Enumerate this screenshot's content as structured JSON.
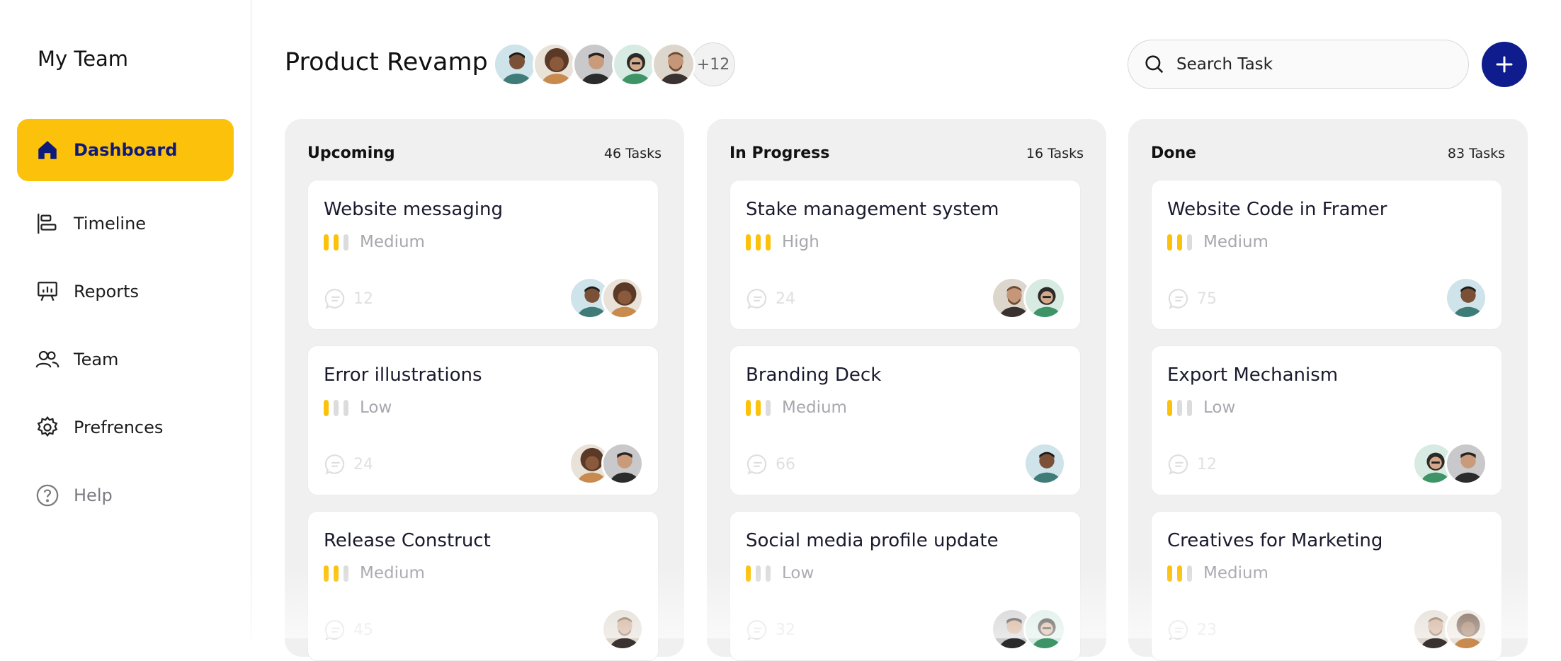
{
  "sidebar": {
    "title": "My Team",
    "items": [
      {
        "label": "Dashboard",
        "icon": "home-icon",
        "active": true
      },
      {
        "label": "Timeline",
        "icon": "timeline-icon"
      },
      {
        "label": "Reports",
        "icon": "presentation-chart-icon"
      },
      {
        "label": "Team",
        "icon": "users-icon"
      },
      {
        "label": "Prefrences",
        "icon": "gear-icon"
      },
      {
        "label": "Help",
        "icon": "help-circle-icon"
      }
    ]
  },
  "header": {
    "project_title": "Product Revamp",
    "members_more": "+12",
    "search_placeholder": "Search Task",
    "add_icon": "plus-icon"
  },
  "colors": {
    "accent": "#FCC10A",
    "primary": "#0F1C8E",
    "column_bg": "#f0f0f0"
  },
  "columns": [
    {
      "title": "Upcoming",
      "count": "46 Tasks",
      "cards": [
        {
          "title": "Website messaging",
          "priority": "Medium",
          "comments": "12"
        },
        {
          "title": "Error illustrations",
          "priority": "Low",
          "comments": "24"
        },
        {
          "title": "Release Construct",
          "priority": "Medium",
          "comments": "45"
        }
      ]
    },
    {
      "title": "In Progress",
      "count": "16 Tasks",
      "cards": [
        {
          "title": "Stake management system",
          "priority": "High",
          "comments": "24"
        },
        {
          "title": "Branding Deck",
          "priority": "Medium",
          "comments": "66"
        },
        {
          "title": "Social media profile update",
          "priority": "Low",
          "comments": "32"
        }
      ]
    },
    {
      "title": "Done",
      "count": "83 Tasks",
      "cards": [
        {
          "title": "Website Code in Framer",
          "priority": "Medium",
          "comments": "75"
        },
        {
          "title": "Export Mechanism",
          "priority": "Low",
          "comments": "12"
        },
        {
          "title": "Creatives for Marketing",
          "priority": "Medium",
          "comments": "23"
        }
      ]
    }
  ]
}
